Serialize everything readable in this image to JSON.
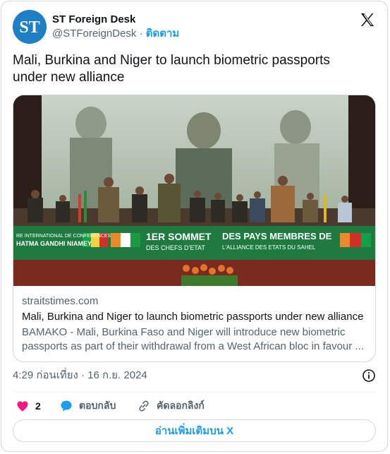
{
  "author": {
    "display_name": "ST Foreign Desk",
    "handle": "@STForeignDesk",
    "separator": "·",
    "follow_label": "ติดตาม",
    "avatar_text": "ST"
  },
  "tweet": {
    "text": "Mali, Burkina and Niger to launch biometric passports under new alliance",
    "timestamp": "4:29 ก่อนเที่ยง · 16 ก.ย. 2024"
  },
  "link_card": {
    "domain": "straitstimes.com",
    "title": "Mali, Burkina and Niger to launch biometric passports under new alliance",
    "description": "BAMAKO - Mali, Burkina Faso and Niger will introduce new biometric passports as part of their withdrawal from a West African bloc in favour ...",
    "image": {
      "banner_left_line1": "RE INTERNATIONAL DE CONFERENCES",
      "banner_left_line2": "HATMA GANDHI NIAMEY",
      "banner_mid_line1": "1ER SOMMET",
      "banner_mid_line2": "DES CHEFS D'ETAT",
      "banner_right_line1": "DES PAYS MEMBRES DE",
      "banner_right_line2": "L'ALLIANCE DES ETATS DU SAHEL"
    }
  },
  "actions": {
    "like_count": "2",
    "reply_label": "ตอบกลับ",
    "copy_link_label": "คัดลอกลิงก์"
  },
  "read_more_label": "อ่านเพิ่มเติมบน X",
  "colors": {
    "accent": "#1d9bf0",
    "like": "#f91880",
    "text": "#0f1419",
    "muted": "#536471",
    "banner_green": "#1f7a3f"
  },
  "icons": [
    "x-logo-icon",
    "info-icon",
    "heart-icon",
    "reply-bubble-icon",
    "link-icon"
  ]
}
